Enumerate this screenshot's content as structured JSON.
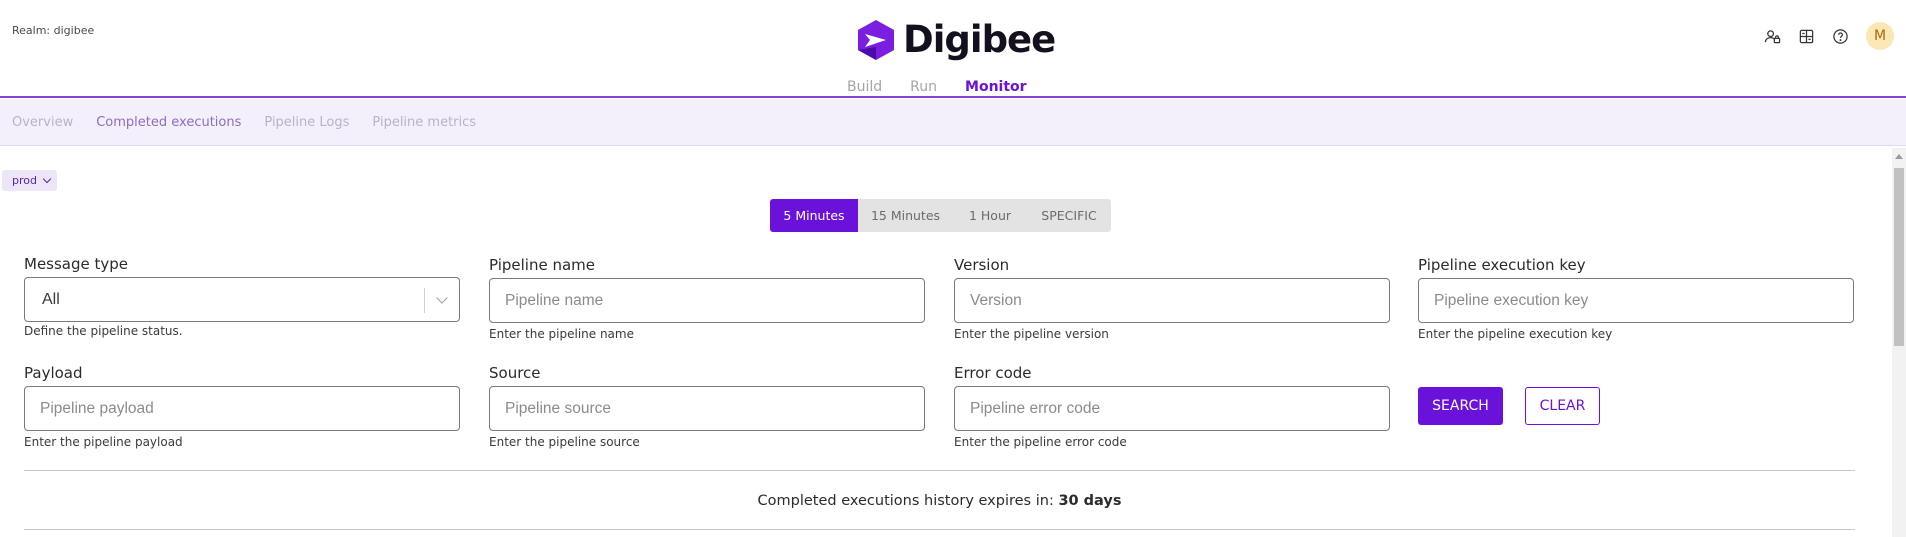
{
  "header": {
    "realm_label": "Realm: digibee",
    "logo_text": "Digibee",
    "nav": [
      "Build",
      "Run",
      "Monitor"
    ],
    "active_nav": "Monitor",
    "avatar_initial": "M",
    "icons": [
      "user-settings-icon",
      "calculator-icon",
      "help-icon"
    ]
  },
  "subnav": {
    "items": [
      "Overview",
      "Completed executions",
      "Pipeline Logs",
      "Pipeline metrics"
    ],
    "active": "Completed executions"
  },
  "environment": {
    "selected": "prod"
  },
  "period": {
    "options": [
      "5 Minutes",
      "15 Minutes",
      "1 Hour",
      "SPECIFIC"
    ],
    "selected": "5 Minutes"
  },
  "filters": {
    "message_type": {
      "label": "Message type",
      "value": "All",
      "help": "Define the pipeline status."
    },
    "pipeline_name": {
      "label": "Pipeline name",
      "placeholder": "Pipeline name",
      "help": "Enter the pipeline name"
    },
    "version": {
      "label": "Version",
      "placeholder": "Version",
      "help": "Enter the pipeline version"
    },
    "execution_key": {
      "label": "Pipeline execution key",
      "placeholder": "Pipeline execution key",
      "help": "Enter the pipeline execution key"
    },
    "payload": {
      "label": "Payload",
      "placeholder": "Pipeline payload",
      "help": "Enter the pipeline payload"
    },
    "source": {
      "label": "Source",
      "placeholder": "Pipeline source",
      "help": "Enter the pipeline source"
    },
    "error_code": {
      "label": "Error code",
      "placeholder": "Pipeline error code",
      "help": "Enter the pipeline error code"
    }
  },
  "actions": {
    "search": "SEARCH",
    "clear": "CLEAR"
  },
  "expiry": {
    "text": "Completed executions history expires in: ",
    "value": "30 days"
  },
  "colors": {
    "accent": "#6a12d9",
    "subnav_bg": "#f4f0fb"
  }
}
